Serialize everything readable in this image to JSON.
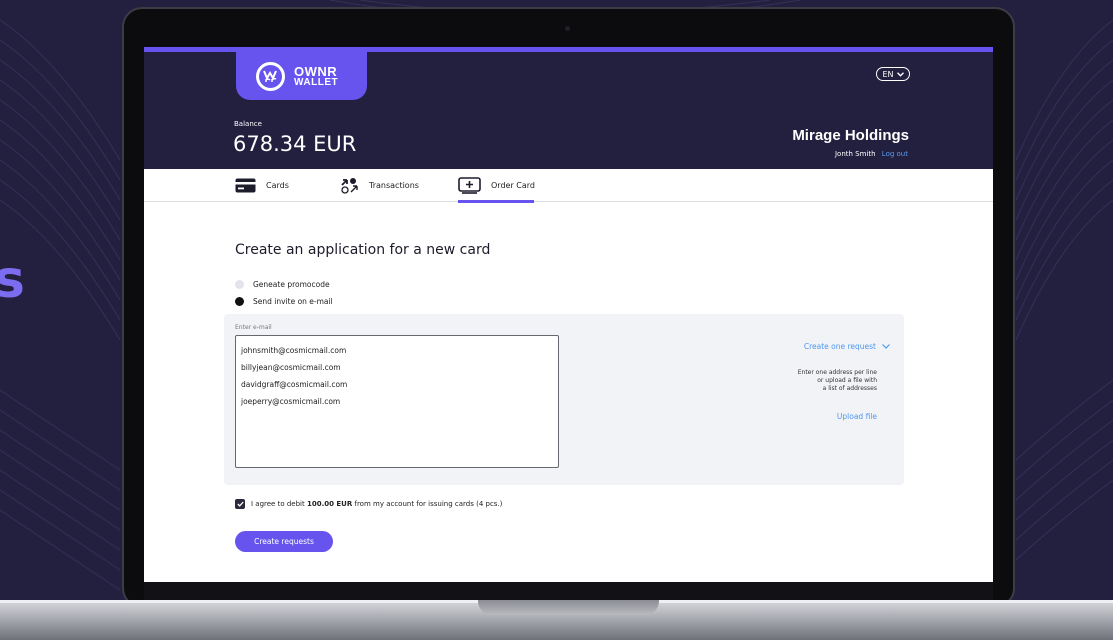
{
  "background": {
    "side_text": "s"
  },
  "header": {
    "logo_title": "OWNR",
    "logo_subtitle": "WALLET",
    "language": "EN",
    "balance_label": "Balance",
    "balance_value": "678.34 EUR",
    "company": "Mirage Holdings",
    "user_name": "Jonth Smith",
    "logout_label": "Log out"
  },
  "tabs": [
    {
      "label": "Cards",
      "icon": "card-icon",
      "active": false
    },
    {
      "label": "Transactions",
      "icon": "transactions-icon",
      "active": false
    },
    {
      "label": "Order Card",
      "icon": "order-card-icon",
      "active": true
    }
  ],
  "form": {
    "title": "Create an application for a new card",
    "option_promocode": "Geneate promocode",
    "option_email": "Send invite on e-mail",
    "selected_option": "option_email",
    "email_label": "Enter e-mail",
    "emails": [
      "johnsmith@cosmicmail.com",
      "billyjean@cosmicmail.com",
      "davidgraff@cosmicmail.com",
      "joeperry@cosmicmail.com"
    ],
    "create_one_label": "Create one request",
    "hint_lines": [
      "Enter one address per line",
      "or upload a file with",
      "a list of addresses"
    ],
    "upload_label": "Upload file",
    "agree_prefix": "I agree to debit ",
    "agree_amount": "100.00 EUR",
    "agree_suffix": " from my account for issuing cards (4 pcs.)",
    "agree_checked": true,
    "submit_label": "Create requests"
  },
  "colors": {
    "brand": "#6754ef",
    "header_bg": "#221f3f",
    "link": "#4f97ee",
    "page_bg": "#23203f"
  }
}
